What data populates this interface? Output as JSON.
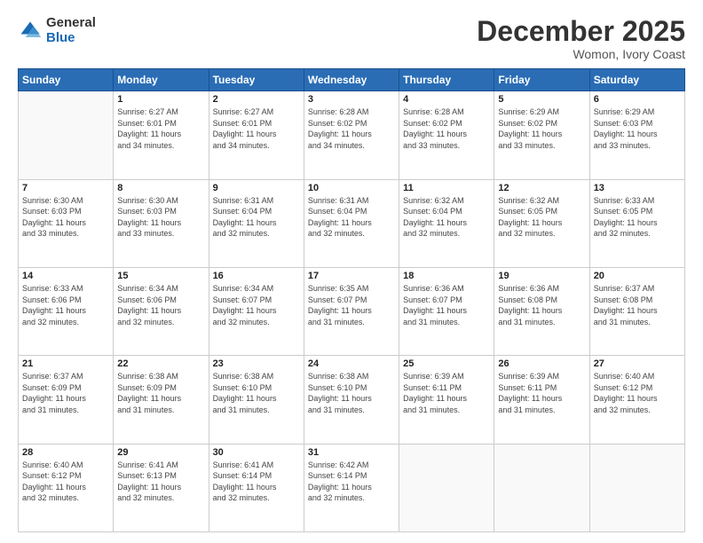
{
  "header": {
    "logo": {
      "general": "General",
      "blue": "Blue"
    },
    "title": "December 2025",
    "subtitle": "Womon, Ivory Coast"
  },
  "calendar": {
    "days_of_week": [
      "Sunday",
      "Monday",
      "Tuesday",
      "Wednesday",
      "Thursday",
      "Friday",
      "Saturday"
    ],
    "weeks": [
      [
        {
          "day": "",
          "info": ""
        },
        {
          "day": "1",
          "info": "Sunrise: 6:27 AM\nSunset: 6:01 PM\nDaylight: 11 hours\nand 34 minutes."
        },
        {
          "day": "2",
          "info": "Sunrise: 6:27 AM\nSunset: 6:01 PM\nDaylight: 11 hours\nand 34 minutes."
        },
        {
          "day": "3",
          "info": "Sunrise: 6:28 AM\nSunset: 6:02 PM\nDaylight: 11 hours\nand 34 minutes."
        },
        {
          "day": "4",
          "info": "Sunrise: 6:28 AM\nSunset: 6:02 PM\nDaylight: 11 hours\nand 33 minutes."
        },
        {
          "day": "5",
          "info": "Sunrise: 6:29 AM\nSunset: 6:02 PM\nDaylight: 11 hours\nand 33 minutes."
        },
        {
          "day": "6",
          "info": "Sunrise: 6:29 AM\nSunset: 6:03 PM\nDaylight: 11 hours\nand 33 minutes."
        }
      ],
      [
        {
          "day": "7",
          "info": "Sunrise: 6:30 AM\nSunset: 6:03 PM\nDaylight: 11 hours\nand 33 minutes."
        },
        {
          "day": "8",
          "info": "Sunrise: 6:30 AM\nSunset: 6:03 PM\nDaylight: 11 hours\nand 33 minutes."
        },
        {
          "day": "9",
          "info": "Sunrise: 6:31 AM\nSunset: 6:04 PM\nDaylight: 11 hours\nand 32 minutes."
        },
        {
          "day": "10",
          "info": "Sunrise: 6:31 AM\nSunset: 6:04 PM\nDaylight: 11 hours\nand 32 minutes."
        },
        {
          "day": "11",
          "info": "Sunrise: 6:32 AM\nSunset: 6:04 PM\nDaylight: 11 hours\nand 32 minutes."
        },
        {
          "day": "12",
          "info": "Sunrise: 6:32 AM\nSunset: 6:05 PM\nDaylight: 11 hours\nand 32 minutes."
        },
        {
          "day": "13",
          "info": "Sunrise: 6:33 AM\nSunset: 6:05 PM\nDaylight: 11 hours\nand 32 minutes."
        }
      ],
      [
        {
          "day": "14",
          "info": "Sunrise: 6:33 AM\nSunset: 6:06 PM\nDaylight: 11 hours\nand 32 minutes."
        },
        {
          "day": "15",
          "info": "Sunrise: 6:34 AM\nSunset: 6:06 PM\nDaylight: 11 hours\nand 32 minutes."
        },
        {
          "day": "16",
          "info": "Sunrise: 6:34 AM\nSunset: 6:07 PM\nDaylight: 11 hours\nand 32 minutes."
        },
        {
          "day": "17",
          "info": "Sunrise: 6:35 AM\nSunset: 6:07 PM\nDaylight: 11 hours\nand 31 minutes."
        },
        {
          "day": "18",
          "info": "Sunrise: 6:36 AM\nSunset: 6:07 PM\nDaylight: 11 hours\nand 31 minutes."
        },
        {
          "day": "19",
          "info": "Sunrise: 6:36 AM\nSunset: 6:08 PM\nDaylight: 11 hours\nand 31 minutes."
        },
        {
          "day": "20",
          "info": "Sunrise: 6:37 AM\nSunset: 6:08 PM\nDaylight: 11 hours\nand 31 minutes."
        }
      ],
      [
        {
          "day": "21",
          "info": "Sunrise: 6:37 AM\nSunset: 6:09 PM\nDaylight: 11 hours\nand 31 minutes."
        },
        {
          "day": "22",
          "info": "Sunrise: 6:38 AM\nSunset: 6:09 PM\nDaylight: 11 hours\nand 31 minutes."
        },
        {
          "day": "23",
          "info": "Sunrise: 6:38 AM\nSunset: 6:10 PM\nDaylight: 11 hours\nand 31 minutes."
        },
        {
          "day": "24",
          "info": "Sunrise: 6:38 AM\nSunset: 6:10 PM\nDaylight: 11 hours\nand 31 minutes."
        },
        {
          "day": "25",
          "info": "Sunrise: 6:39 AM\nSunset: 6:11 PM\nDaylight: 11 hours\nand 31 minutes."
        },
        {
          "day": "26",
          "info": "Sunrise: 6:39 AM\nSunset: 6:11 PM\nDaylight: 11 hours\nand 31 minutes."
        },
        {
          "day": "27",
          "info": "Sunrise: 6:40 AM\nSunset: 6:12 PM\nDaylight: 11 hours\nand 32 minutes."
        }
      ],
      [
        {
          "day": "28",
          "info": "Sunrise: 6:40 AM\nSunset: 6:12 PM\nDaylight: 11 hours\nand 32 minutes."
        },
        {
          "day": "29",
          "info": "Sunrise: 6:41 AM\nSunset: 6:13 PM\nDaylight: 11 hours\nand 32 minutes."
        },
        {
          "day": "30",
          "info": "Sunrise: 6:41 AM\nSunset: 6:14 PM\nDaylight: 11 hours\nand 32 minutes."
        },
        {
          "day": "31",
          "info": "Sunrise: 6:42 AM\nSunset: 6:14 PM\nDaylight: 11 hours\nand 32 minutes."
        },
        {
          "day": "",
          "info": ""
        },
        {
          "day": "",
          "info": ""
        },
        {
          "day": "",
          "info": ""
        }
      ]
    ]
  }
}
